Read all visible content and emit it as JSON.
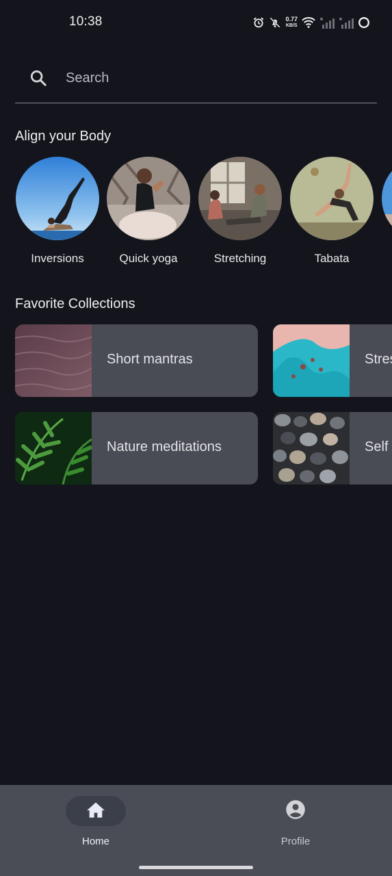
{
  "status_bar": {
    "time": "10:38",
    "net_speed_value": "0.77",
    "net_speed_unit": "KB/S",
    "icons": [
      "alarm-icon",
      "bell-off-icon",
      "wifi-icon",
      "signal-icon",
      "signal-icon",
      "circle-icon"
    ]
  },
  "search": {
    "placeholder": "Search"
  },
  "align_section": {
    "title": "Align your Body",
    "items": [
      {
        "label": "Inversions"
      },
      {
        "label": "Quick yoga"
      },
      {
        "label": "Stretching"
      },
      {
        "label": "Tabata"
      }
    ]
  },
  "collections_section": {
    "title": "Favorite Collections",
    "items": [
      {
        "label": "Short mantras"
      },
      {
        "label": "Stress and anxiety"
      },
      {
        "label": "Nature meditations"
      },
      {
        "label": "Self massage"
      }
    ]
  },
  "bottom_nav": {
    "items": [
      {
        "label": "Home",
        "icon": "home-icon",
        "active": true
      },
      {
        "label": "Profile",
        "icon": "account-circle-icon",
        "active": false
      }
    ]
  },
  "colors": {
    "background": "#14151c",
    "card": "#494c55",
    "nav_background": "#4a4d56",
    "nav_active_pill": "#3b3f4a"
  }
}
